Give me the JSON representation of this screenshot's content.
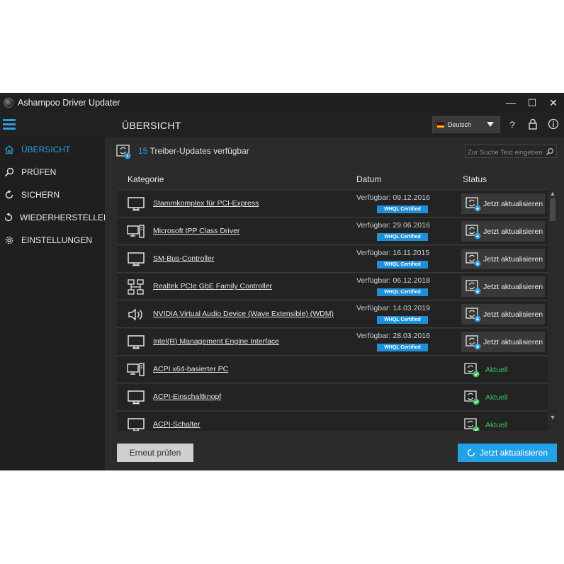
{
  "window": {
    "title": "Ashampoo Driver Updater",
    "controls": {
      "minimize": "—",
      "maximize": "☐",
      "close": "✕"
    }
  },
  "header": {
    "page_title": "ÜBERSICHT",
    "language": "Deutsch",
    "help": "?"
  },
  "sidebar": {
    "items": [
      {
        "label": "ÜBERSICHT",
        "icon": "home-icon",
        "active": true
      },
      {
        "label": "PRÜFEN",
        "icon": "search-icon"
      },
      {
        "label": "SICHERN",
        "icon": "backup-icon"
      },
      {
        "label": "WIEDERHERSTELLEN",
        "icon": "restore-icon"
      },
      {
        "label": "EINSTELLUNGEN",
        "icon": "gear-icon"
      }
    ]
  },
  "summary": {
    "count": "15",
    "text": "Treiber-Updates verfügbar"
  },
  "search": {
    "placeholder": "Zur Suche Text eingeben"
  },
  "table": {
    "headers": {
      "category": "Kategorie",
      "date": "Datum",
      "status": "Status"
    },
    "whql_label": "WHQL Certified",
    "update_label": "Jetzt aktualisieren",
    "current_label": "Aktuell",
    "rows": [
      {
        "name": "Stammkomplex für PCI-Express",
        "icon": "monitor-icon",
        "date": "Verfügbar: 09.12.2016",
        "status": "update"
      },
      {
        "name": "Microsoft IPP Class Driver",
        "icon": "computer-icon",
        "date": "Verfügbar: 29.06.2016",
        "status": "update"
      },
      {
        "name": "SM-Bus-Controller",
        "icon": "monitor-icon",
        "date": "Verfügbar: 16.11.2015",
        "status": "update"
      },
      {
        "name": "Realtek PCIe GbE Family Controller",
        "icon": "network-icon",
        "date": "Verfügbar: 06.12.2018",
        "status": "update"
      },
      {
        "name": "NVIDIA Virtual Audio Device (Wave Extensible) (WDM)",
        "icon": "speaker-icon",
        "date": "Verfügbar: 14.03.2019",
        "status": "update"
      },
      {
        "name": "Intel(R) Management Engine Interface",
        "icon": "monitor-icon",
        "date": "Verfügbar: 28.03.2016",
        "status": "update"
      },
      {
        "name": "ACPI x64-basierter PC",
        "icon": "computer-icon",
        "date": "",
        "status": "current"
      },
      {
        "name": "ACPI-Einschaltknopf",
        "icon": "monitor-icon",
        "date": "",
        "status": "current"
      },
      {
        "name": "ACPI-Schalter",
        "icon": "monitor-icon",
        "date": "",
        "status": "current"
      }
    ]
  },
  "footer": {
    "recheck_label": "Erneut prüfen",
    "update_all_label": "Jetzt aktualisieren"
  },
  "colors": {
    "accent": "#2d9bde",
    "current": "#3cc15d",
    "whql": "#1f8fd8"
  }
}
